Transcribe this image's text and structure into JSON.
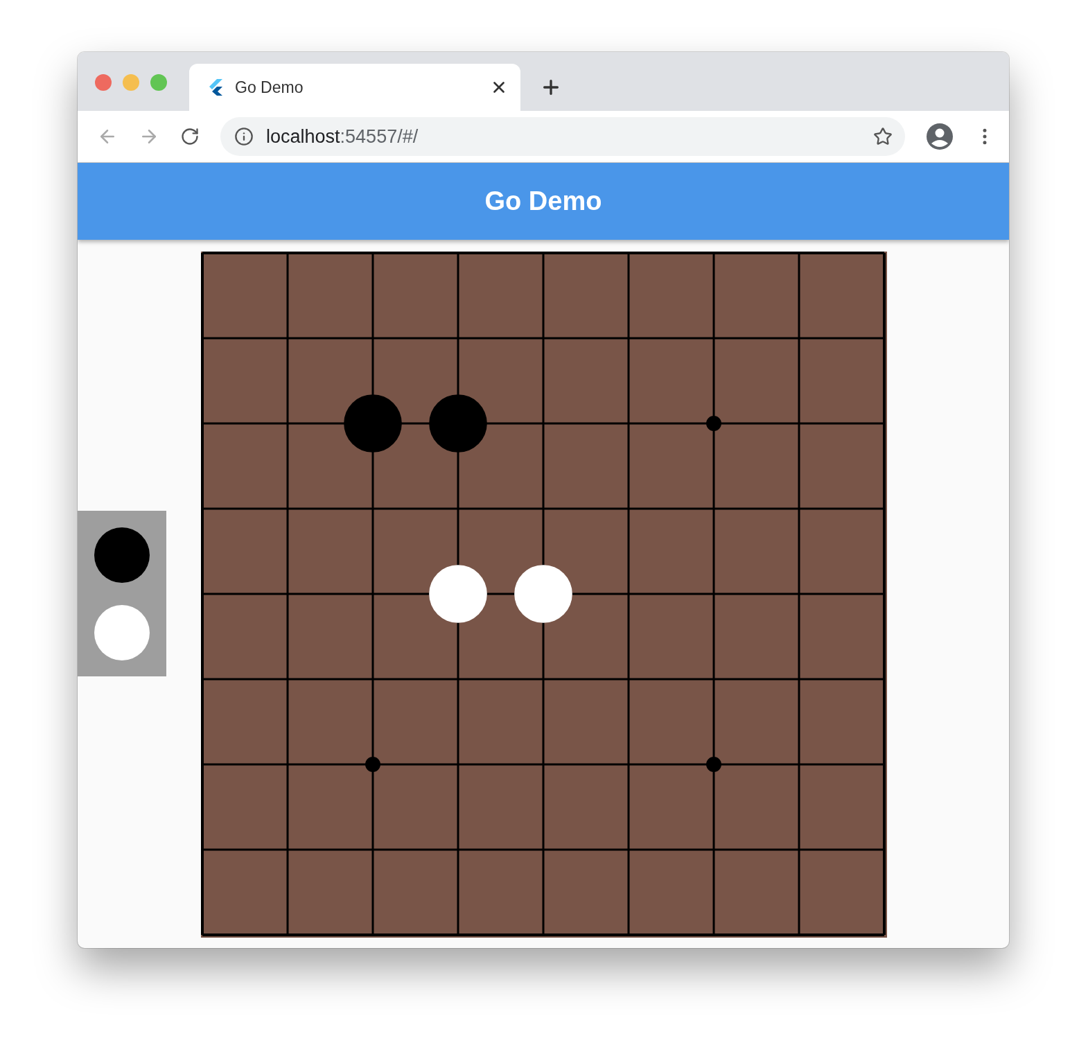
{
  "browser": {
    "tab": {
      "title": "Go Demo",
      "selected": true
    },
    "url_host": "localhost",
    "url_rest": ":54557/#/"
  },
  "app_bar": {
    "title": "Go Demo"
  },
  "player_panel": [
    {
      "kind": "black"
    },
    {
      "kind": "white"
    }
  ],
  "board": {
    "rows": [
      {
        "points": [
          {
            "kind": "empty"
          },
          {
            "kind": "empty"
          },
          {
            "kind": "empty"
          },
          {
            "kind": "empty"
          },
          {
            "kind": "empty"
          },
          {
            "kind": "empty"
          },
          {
            "kind": "empty"
          },
          {
            "kind": "empty"
          },
          {
            "kind": "empty"
          }
        ]
      },
      {
        "points": [
          {
            "kind": "empty"
          },
          {
            "kind": "empty"
          },
          {
            "kind": "empty"
          },
          {
            "kind": "empty"
          },
          {
            "kind": "empty"
          },
          {
            "kind": "empty"
          },
          {
            "kind": "empty"
          },
          {
            "kind": "empty"
          },
          {
            "kind": "empty"
          }
        ]
      },
      {
        "points": [
          {
            "kind": "empty"
          },
          {
            "kind": "empty"
          },
          {
            "kind": "black"
          },
          {
            "kind": "black"
          },
          {
            "kind": "empty"
          },
          {
            "kind": "empty"
          },
          {
            "kind": "star"
          },
          {
            "kind": "empty"
          },
          {
            "kind": "empty"
          }
        ]
      },
      {
        "points": [
          {
            "kind": "empty"
          },
          {
            "kind": "empty"
          },
          {
            "kind": "empty"
          },
          {
            "kind": "empty"
          },
          {
            "kind": "empty"
          },
          {
            "kind": "empty"
          },
          {
            "kind": "empty"
          },
          {
            "kind": "empty"
          },
          {
            "kind": "empty"
          }
        ]
      },
      {
        "points": [
          {
            "kind": "empty"
          },
          {
            "kind": "empty"
          },
          {
            "kind": "empty"
          },
          {
            "kind": "white"
          },
          {
            "kind": "white"
          },
          {
            "kind": "empty"
          },
          {
            "kind": "empty"
          },
          {
            "kind": "empty"
          },
          {
            "kind": "empty"
          }
        ]
      },
      {
        "points": [
          {
            "kind": "empty"
          },
          {
            "kind": "empty"
          },
          {
            "kind": "empty"
          },
          {
            "kind": "empty"
          },
          {
            "kind": "empty"
          },
          {
            "kind": "empty"
          },
          {
            "kind": "empty"
          },
          {
            "kind": "empty"
          },
          {
            "kind": "empty"
          }
        ]
      },
      {
        "points": [
          {
            "kind": "empty"
          },
          {
            "kind": "empty"
          },
          {
            "kind": "star"
          },
          {
            "kind": "empty"
          },
          {
            "kind": "empty"
          },
          {
            "kind": "empty"
          },
          {
            "kind": "star"
          },
          {
            "kind": "empty"
          },
          {
            "kind": "empty"
          }
        ]
      },
      {
        "points": [
          {
            "kind": "empty"
          },
          {
            "kind": "empty"
          },
          {
            "kind": "empty"
          },
          {
            "kind": "empty"
          },
          {
            "kind": "empty"
          },
          {
            "kind": "empty"
          },
          {
            "kind": "empty"
          },
          {
            "kind": "empty"
          },
          {
            "kind": "empty"
          }
        ]
      },
      {
        "points": [
          {
            "kind": "empty"
          },
          {
            "kind": "empty"
          },
          {
            "kind": "empty"
          },
          {
            "kind": "empty"
          },
          {
            "kind": "empty"
          },
          {
            "kind": "empty"
          },
          {
            "kind": "empty"
          },
          {
            "kind": "empty"
          },
          {
            "kind": "empty"
          }
        ]
      }
    ]
  }
}
